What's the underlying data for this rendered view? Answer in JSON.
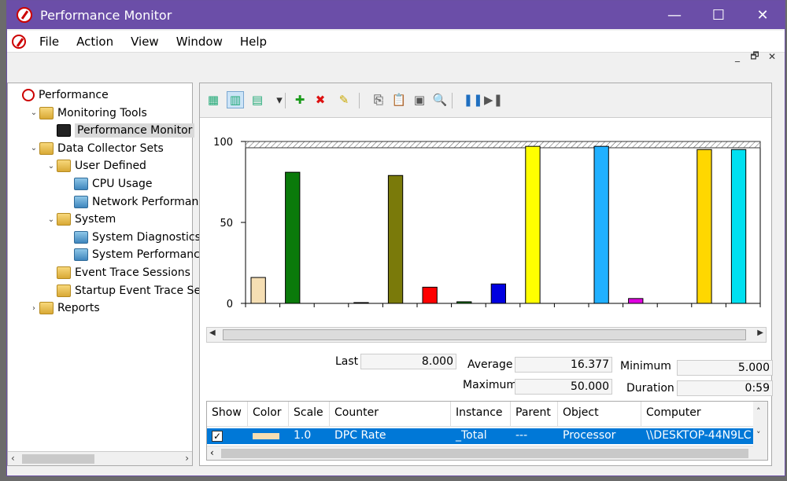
{
  "window": {
    "title": "Performance Monitor"
  },
  "titlebar_buttons": {
    "minimize": "—",
    "maximize": "☐",
    "close": "✕"
  },
  "menu": [
    "File",
    "Action",
    "View",
    "Window",
    "Help"
  ],
  "mdi_buttons": {
    "minimize": "_",
    "restore": "🗗",
    "close": "✕"
  },
  "tree": [
    {
      "label": "Performance",
      "depth": 0,
      "chevron": "",
      "icon": "perf"
    },
    {
      "label": "Monitoring Tools",
      "depth": 1,
      "chevron": "⌄",
      "icon": "folder"
    },
    {
      "label": "Performance Monitor",
      "depth": 2,
      "chevron": "",
      "icon": "monitor",
      "selected": true
    },
    {
      "label": "Data Collector Sets",
      "depth": 1,
      "chevron": "⌄",
      "icon": "folder"
    },
    {
      "label": "User Defined",
      "depth": 2,
      "chevron": "⌄",
      "icon": "folder"
    },
    {
      "label": "CPU Usage",
      "depth": 3,
      "chevron": "",
      "icon": "set"
    },
    {
      "label": "Network Performan",
      "depth": 3,
      "chevron": "",
      "icon": "set"
    },
    {
      "label": "System",
      "depth": 2,
      "chevron": "⌄",
      "icon": "folder"
    },
    {
      "label": "System Diagnostics",
      "depth": 3,
      "chevron": "",
      "icon": "set"
    },
    {
      "label": "System Performanc",
      "depth": 3,
      "chevron": "",
      "icon": "set"
    },
    {
      "label": "Event Trace Sessions",
      "depth": 2,
      "chevron": "",
      "icon": "folder"
    },
    {
      "label": "Startup Event Trace Ses",
      "depth": 2,
      "chevron": "",
      "icon": "folder"
    },
    {
      "label": "Reports",
      "depth": 1,
      "chevron": "›",
      "icon": "reports"
    }
  ],
  "toolbar_icons": [
    "view-graph-icon",
    "view-histogram-icon",
    "view-report-icon",
    "dropdown-icon",
    "add-counter-icon",
    "delete-counter-icon",
    "highlight-icon",
    "copy-properties-icon",
    "paste-counter-list-icon",
    "properties-icon",
    "zoom-icon",
    "freeze-display-icon",
    "update-data-icon"
  ],
  "chart_data": {
    "type": "bar",
    "y_ticks": [
      "100",
      "50",
      "0"
    ],
    "ylim": [
      0,
      100
    ],
    "bars": [
      {
        "value": 16,
        "color": "#f5deb3"
      },
      {
        "value": 81,
        "color": "#0a7a0a"
      },
      {
        "value": 0,
        "color": "#ffffff"
      },
      {
        "value": 0.5,
        "color": "#000000"
      },
      {
        "value": 79,
        "color": "#7a7a0a"
      },
      {
        "value": 10,
        "color": "#ff0000"
      },
      {
        "value": 1,
        "color": "#0a7a0a"
      },
      {
        "value": 12,
        "color": "#0000e0"
      },
      {
        "value": 97,
        "color": "#ffff00"
      },
      {
        "value": 0,
        "color": "#ffffff"
      },
      {
        "value": 97,
        "color": "#20b0ff"
      },
      {
        "value": 3,
        "color": "#e000e0"
      },
      {
        "value": 0,
        "color": "#ffffff"
      },
      {
        "value": 95,
        "color": "#ffd700"
      },
      {
        "value": 95,
        "color": "#00e0f0"
      }
    ]
  },
  "stats": {
    "last_label": "Last",
    "last_value": "8.000",
    "average_label": "Average",
    "average_value": "16.377",
    "minimum_label": "Minimum",
    "minimum_value": "5.000",
    "maximum_label": "Maximum",
    "maximum_value": "50.000",
    "duration_label": "Duration",
    "duration_value": "0:59"
  },
  "grid": {
    "headers": [
      "Show",
      "Color",
      "Scale",
      "Counter",
      "Instance",
      "Parent",
      "Object",
      "Computer"
    ],
    "row": {
      "show": "✓",
      "scale": "1.0",
      "counter": "DPC Rate",
      "instance": "_Total",
      "parent": "---",
      "object": "Processor",
      "computer": "\\\\DESKTOP-44N9LC"
    }
  }
}
